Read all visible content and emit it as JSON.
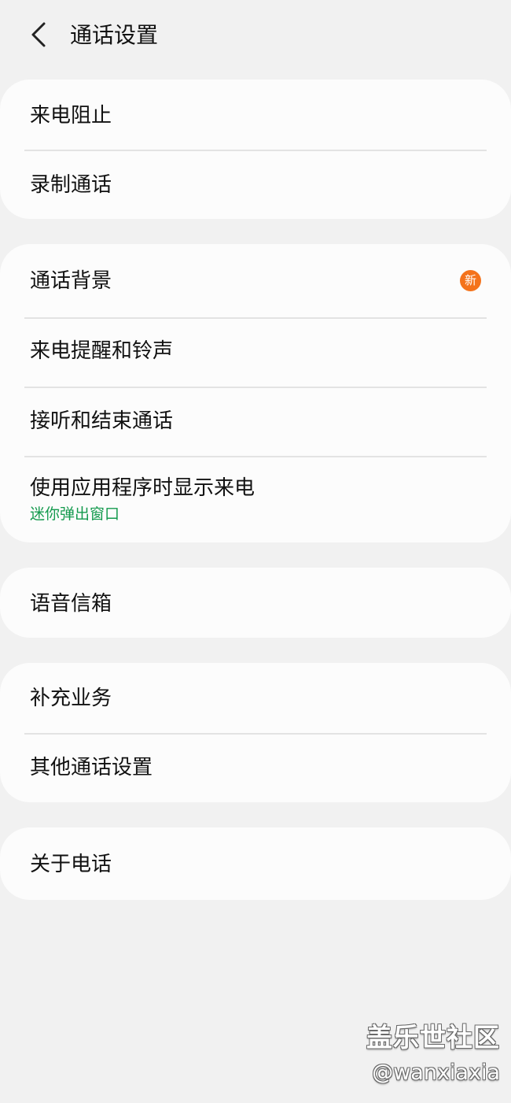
{
  "header": {
    "title": "通话设置",
    "back_icon": "back-arrow-icon"
  },
  "groups": [
    {
      "items": [
        {
          "label": "来电阻止"
        },
        {
          "label": "录制通话"
        }
      ]
    },
    {
      "items": [
        {
          "label": "通话背景",
          "badge": "新"
        },
        {
          "label": "来电提醒和铃声"
        },
        {
          "label": "接听和结束通话"
        },
        {
          "label": "使用应用程序时显示来电",
          "subtitle": "迷你弹出窗口"
        }
      ]
    },
    {
      "items": [
        {
          "label": "语音信箱"
        }
      ]
    },
    {
      "items": [
        {
          "label": "补充业务"
        },
        {
          "label": "其他通话设置"
        }
      ]
    },
    {
      "items": [
        {
          "label": "关于电话"
        }
      ]
    }
  ],
  "watermark": {
    "title": "盖乐世社区",
    "handle": "@wanxiaxia"
  },
  "colors": {
    "background": "#f1f1f1",
    "card": "#fcfcfc",
    "subtitle_accent": "#149a4e",
    "badge": "#f4731c"
  }
}
